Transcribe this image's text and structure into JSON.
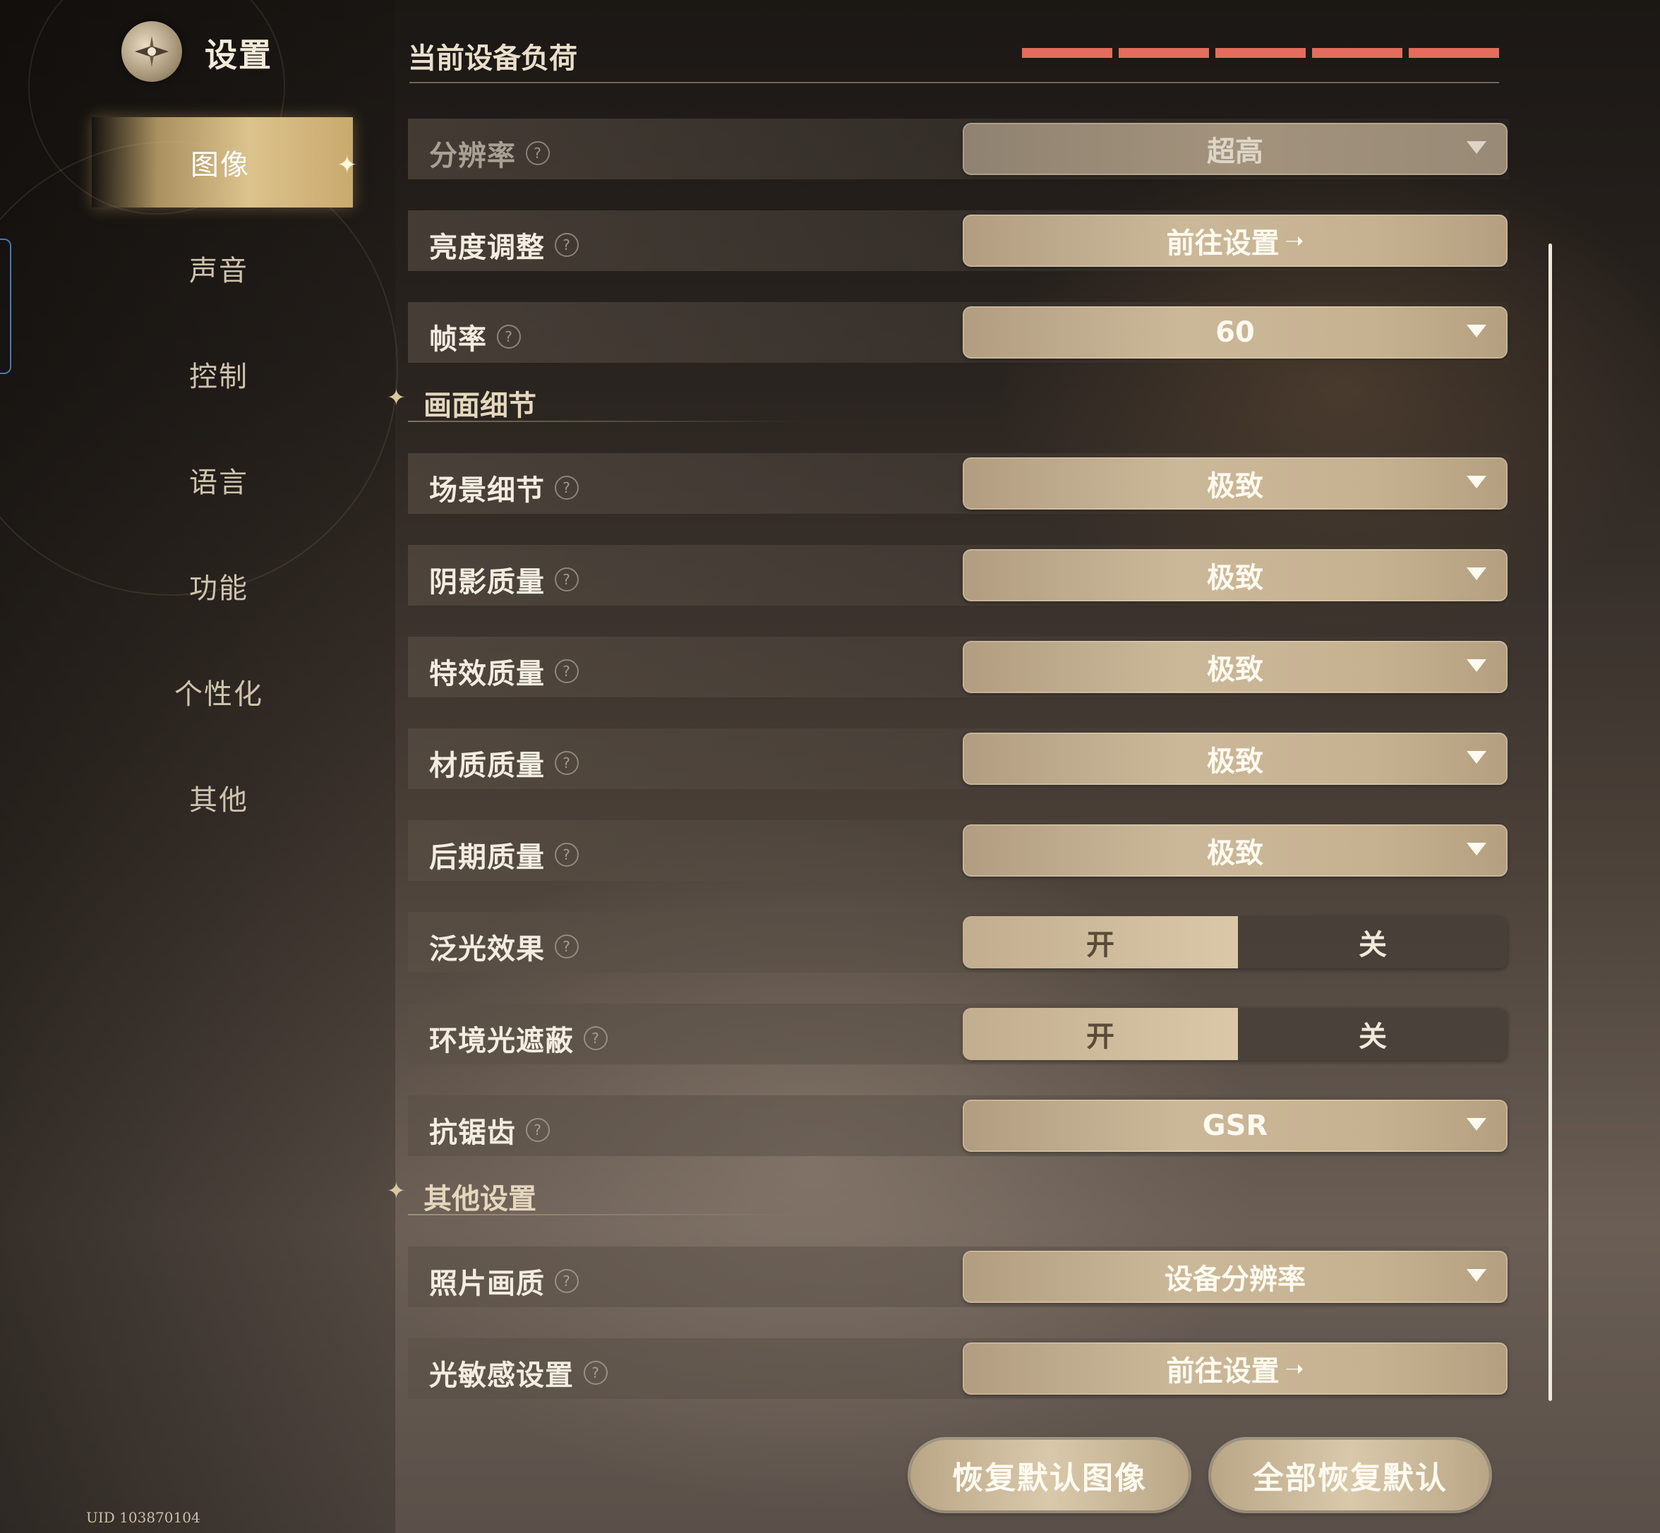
{
  "header": {
    "title": "设置"
  },
  "nav": {
    "items": [
      {
        "label": "图像",
        "active": true
      },
      {
        "label": "声音"
      },
      {
        "label": "控制"
      },
      {
        "label": "语言"
      },
      {
        "label": "功能"
      },
      {
        "label": "个性化"
      },
      {
        "label": "其他"
      }
    ]
  },
  "load": {
    "title": "当前设备负荷",
    "segments": 5,
    "color": "#e46d5c"
  },
  "rows": {
    "resolution": {
      "label": "分辨率",
      "value": "超高"
    },
    "brightness": {
      "label": "亮度调整",
      "value": "前往设置"
    },
    "framerate": {
      "label": "帧率",
      "value": "60"
    },
    "section_detail": {
      "title": "画面细节"
    },
    "scene": {
      "label": "场景细节",
      "value": "极致"
    },
    "shadow": {
      "label": "阴影质量",
      "value": "极致"
    },
    "effects": {
      "label": "特效质量",
      "value": "极致"
    },
    "material": {
      "label": "材质质量",
      "value": "极致"
    },
    "post": {
      "label": "后期质量",
      "value": "极致"
    },
    "bloom": {
      "label": "泛光效果",
      "on": "开",
      "off": "关"
    },
    "ao": {
      "label": "环境光遮蔽",
      "on": "开",
      "off": "关"
    },
    "aa": {
      "label": "抗锯齿",
      "value": "GSR"
    },
    "section_other": {
      "title": "其他设置"
    },
    "photo": {
      "label": "照片画质",
      "value": "设备分辨率"
    },
    "photosens": {
      "label": "光敏感设置",
      "value": "前往设置"
    }
  },
  "buttons": {
    "reset_image": "恢复默认图像",
    "reset_all": "全部恢复默认"
  },
  "footer": {
    "uid": "UID 103870104"
  }
}
